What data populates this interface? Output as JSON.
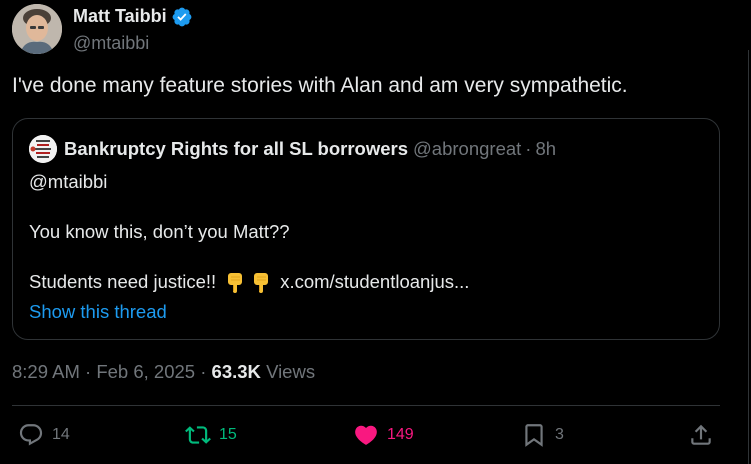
{
  "author": {
    "display_name": "Matt Taibbi",
    "handle": "@mtaibbi",
    "verified_color": "#1d9bf0"
  },
  "tweet": {
    "text": "I've done many feature stories with Alan and am very sympathetic."
  },
  "quoted_tweet": {
    "display_name": "Bankruptcy Rights for all SL borrowers",
    "handle": "@abrongreat",
    "separator": "·",
    "time_ago": "8h",
    "lines": [
      "@mtaibbi",
      "You know this, don’t you Matt??",
      "Students need justice!!"
    ],
    "link": "x.com/studentloanjus...",
    "show_thread": "Show this thread"
  },
  "meta": {
    "time": "8:29 AM",
    "sep1": "·",
    "date": "Feb 6, 2025",
    "sep2": "·",
    "views_count": "63.3K",
    "views_label": "Views"
  },
  "actions": {
    "replies": "14",
    "retweets": "15",
    "likes": "149",
    "bookmarks": "3"
  },
  "colors": {
    "background": "#000000",
    "text": "#e7e9ea",
    "muted": "#71767b",
    "link": "#1d9bf0",
    "retweet": "#00ba7c",
    "like": "#f91880",
    "border": "#2f3336"
  },
  "icons": {
    "reply": "reply-icon",
    "retweet": "retweet-icon",
    "like": "heart-icon",
    "bookmark": "bookmark-icon",
    "share": "share-icon",
    "verified": "verified-badge-icon",
    "emoji": "backhand-index-pointing-down-emoji"
  }
}
